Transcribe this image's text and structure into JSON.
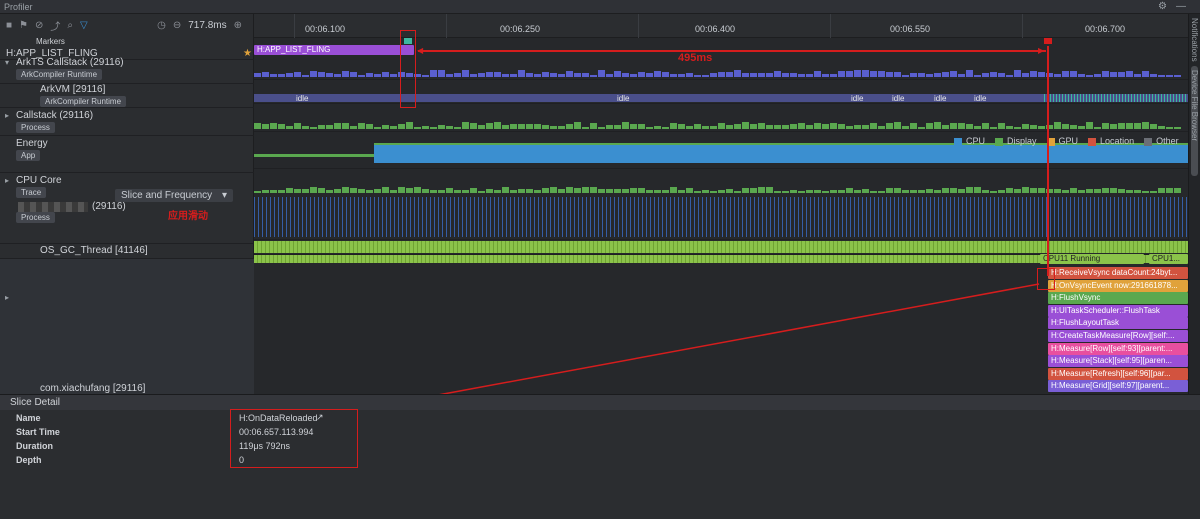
{
  "window": {
    "title": "Profiler"
  },
  "toolbar": {
    "zoom_value": "717.8ms"
  },
  "ruler": {
    "ticks": [
      "00:06.100",
      "00:06.250",
      "00:06.400",
      "00:06.550",
      "00:06.700"
    ]
  },
  "rows": {
    "markers": {
      "label": "Markers"
    },
    "fling": {
      "label": "H:APP_LIST_FLING",
      "slice": "H:APP_LIST_FLING"
    },
    "arkts": {
      "label": "ArkTS Callstack (29116)",
      "chip": "ArkCompiler Runtime"
    },
    "arkvm": {
      "label": "ArkVM [29116]",
      "chip": "ArkCompiler Runtime",
      "idle_texts": [
        "idle",
        "idle",
        "idle",
        "idle",
        "idle",
        "idle"
      ]
    },
    "callstack": {
      "label": "Callstack (29116)",
      "chip": "Process"
    },
    "energy": {
      "label": "Energy",
      "chip": "App",
      "legend": [
        "CPU",
        "Display",
        "GPU",
        "Location",
        "Other"
      ]
    },
    "cpucore": {
      "label": "CPU Core",
      "chip": "Trace",
      "dropdown": "Slice and Frequency"
    },
    "process": {
      "label": "(29116)",
      "chip": "Process",
      "annotation": "应用滑动"
    },
    "gc": {
      "label": "OS_GC_Thread [41146]",
      "cpu_running": "CPU11 Running",
      "cpu_short": "CPU1..."
    },
    "main_thread": {
      "label": "com.xiachufang [29116]"
    }
  },
  "annotation": {
    "measure": "495ms"
  },
  "slices": [
    "H:ReceiveVsync dataCount:24byt...",
    "H:OnVsyncEvent now:291661878...",
    "H:FlushVsync",
    "H:UITaskScheduler::FlushTask",
    "H:FlushLayoutTask",
    "H:CreateTaskMeasure[Row][self:...",
    "H:Measure[Row][self:93][parent:...",
    "H:Measure[Stack][self:95][paren...",
    "H:Measure[Refresh][self:96][par...",
    "H:Measure[Grid][self:97][parent..."
  ],
  "side_tabs": [
    "Notifications",
    "Device File Browser"
  ],
  "detail": {
    "title": "Slice Detail",
    "fields": [
      {
        "key": "Name",
        "value": "H:OnDataReloaded"
      },
      {
        "key": "Start Time",
        "value": "00:06.657.113.994"
      },
      {
        "key": "Duration",
        "value": "119μs 792ns"
      },
      {
        "key": "Depth",
        "value": "0"
      }
    ]
  },
  "colors": {
    "accent": "#9a4fd6",
    "annotation_red": "#d51d1d",
    "cpu": "#3b8fd0",
    "display": "#5aa84f",
    "gpu": "#e0a23b",
    "location": "#d2533f",
    "other": "#6b6f76"
  }
}
